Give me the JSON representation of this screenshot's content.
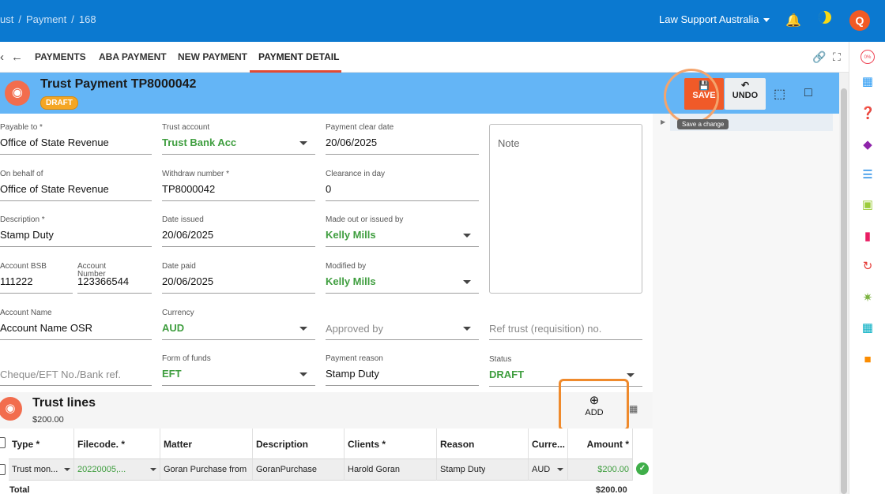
{
  "breadcrumb": [
    "ust",
    "/",
    "Payment",
    "/",
    "168"
  ],
  "topbar": {
    "org": "Law Support Australia"
  },
  "user": {
    "initial": "Q"
  },
  "tabs": [
    {
      "label": "PAYMENTS"
    },
    {
      "label": "ABA PAYMENT"
    },
    {
      "label": "NEW PAYMENT"
    },
    {
      "label": "PAYMENT DETAIL"
    }
  ],
  "header": {
    "title": "Trust Payment TP8000042",
    "status_badge": "DRAFT",
    "save_label": "SAVE",
    "undo_label": "UNDO",
    "save_tooltip": "Save a change"
  },
  "form": {
    "payable_to": {
      "label": "Payable to *",
      "value": "Office of State Revenue"
    },
    "trust_account": {
      "label": "Trust account",
      "value": "Trust Bank Acc"
    },
    "payment_clear_date": {
      "label": "Payment clear date",
      "value": "20/06/2025"
    },
    "note": {
      "placeholder": "Note"
    },
    "on_behalf_of": {
      "label": "On behalf of",
      "value": "Office of State Revenue"
    },
    "withdraw_number": {
      "label": "Withdraw number *",
      "value": "TP8000042"
    },
    "clearance_in_day": {
      "label": "Clearance in day",
      "value": "0"
    },
    "description": {
      "label": "Description *",
      "value": "Stamp Duty"
    },
    "date_issued": {
      "label": "Date issued",
      "value": "20/06/2025"
    },
    "made_out_by": {
      "label": "Made out or issued by",
      "value": "Kelly Mills"
    },
    "account_bsb": {
      "label": "Account BSB",
      "value": "111222"
    },
    "account_number": {
      "label": "Account Number",
      "value": "123366544"
    },
    "date_paid": {
      "label": "Date paid",
      "value": "20/06/2025"
    },
    "modified_by": {
      "label": "Modified by",
      "value": "Kelly Mills"
    },
    "account_name": {
      "label": "Account Name",
      "value": "Account Name OSR"
    },
    "currency": {
      "label": "Currency",
      "value": "AUD"
    },
    "approved_by": {
      "placeholder": "Approved by"
    },
    "ref_trust": {
      "placeholder": "Ref trust (requisition) no."
    },
    "cheque_ref": {
      "placeholder": "Cheque/EFT No./Bank ref."
    },
    "form_of_funds": {
      "label": "Form of funds",
      "value": "EFT"
    },
    "payment_reason": {
      "label": "Payment reason",
      "value": "Stamp Duty"
    },
    "status": {
      "label": "Status",
      "value": "DRAFT"
    }
  },
  "trust_lines": {
    "title": "Trust lines",
    "total": "$200.00",
    "add_label": "ADD",
    "columns": [
      "Type *",
      "Filecode. *",
      "Matter",
      "Description",
      "Clients *",
      "Reason",
      "Curre...",
      "Amount *"
    ],
    "rows": [
      [
        "Trust mon...",
        "20220005,...",
        "Goran Purchase from",
        "GoranPurchase",
        "Harold Goran",
        "Stamp Duty",
        "AUD",
        "$200.00"
      ]
    ],
    "total_label": "Total",
    "total_value": "$200.00"
  },
  "rail_badge": "0%"
}
